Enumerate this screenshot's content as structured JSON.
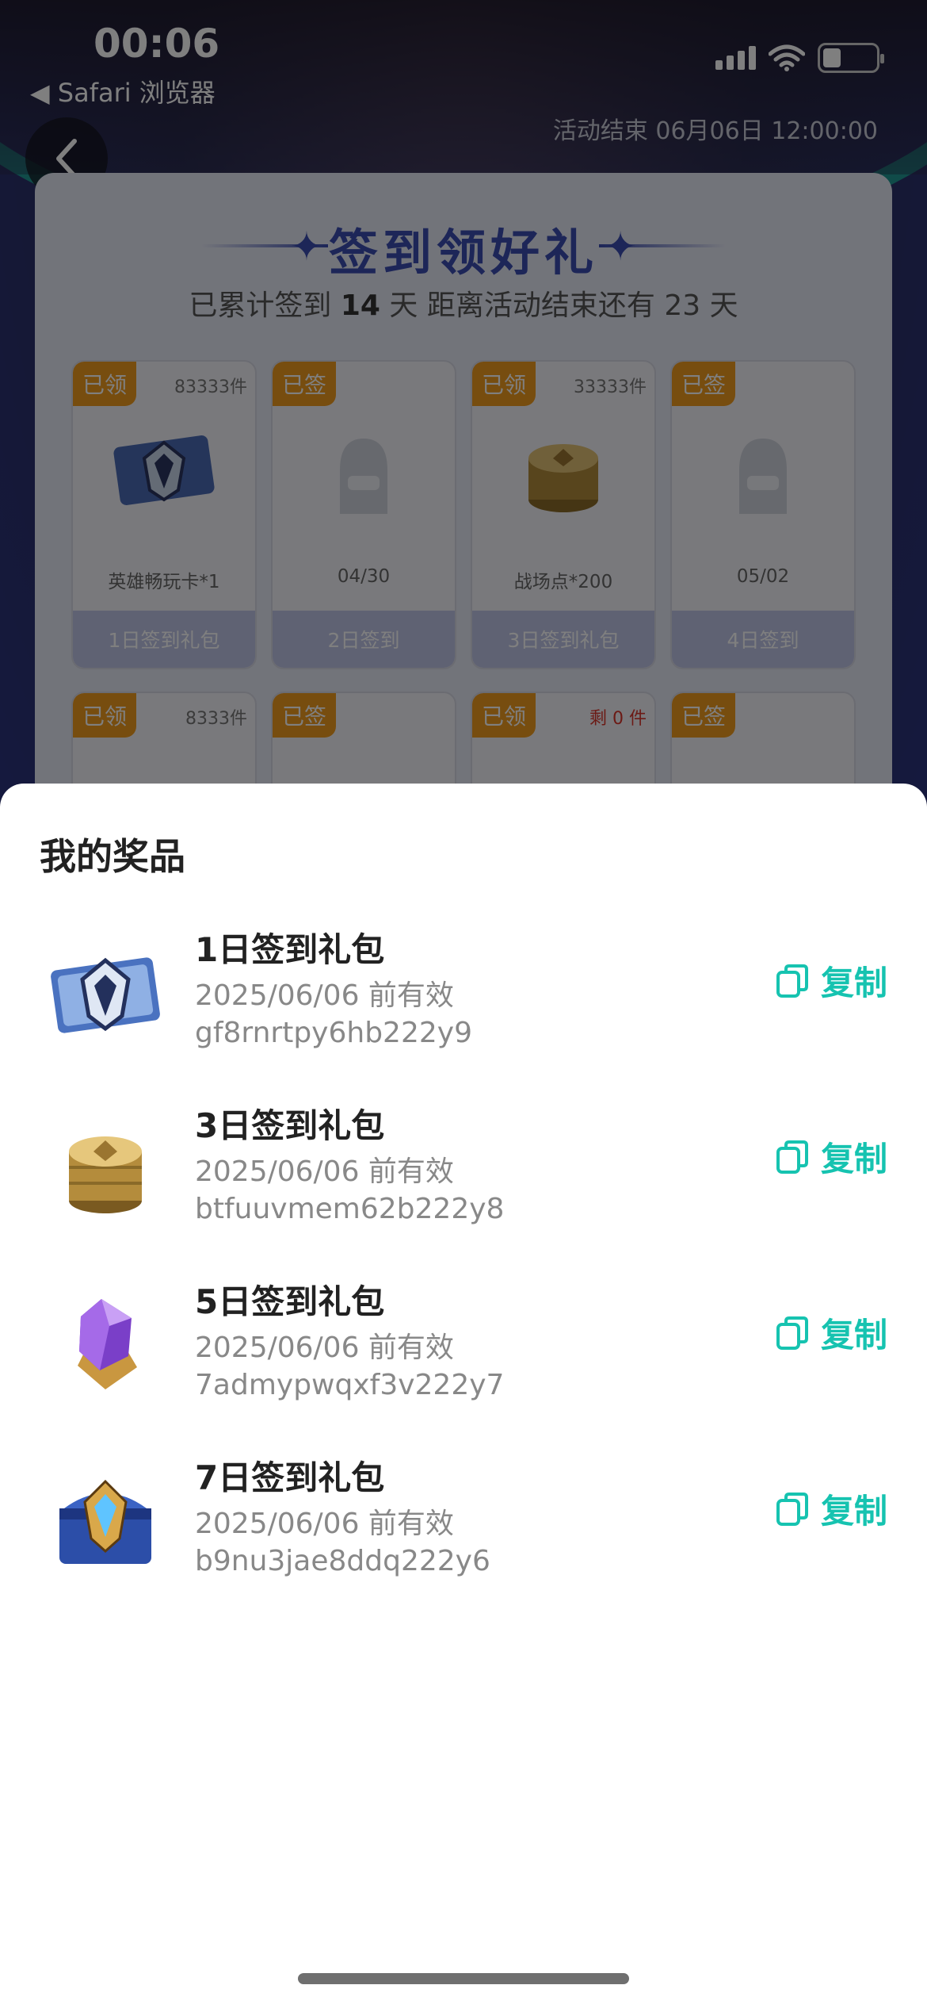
{
  "status_bar": {
    "time": "00:06",
    "back_app": "◀ Safari 浏览器"
  },
  "activity": {
    "end_time": "活动结束 06月06日 12:00:00"
  },
  "checkin_card": {
    "title": "签到领好礼",
    "summary_prefix": "已累计签到",
    "days_signed": "14",
    "summary_mid": "天  距离活动结束还有",
    "days_left": "23",
    "summary_suffix": "天",
    "rows": [
      [
        {
          "tag": "已领",
          "count": "83333件",
          "count_red": false,
          "image": "hero-card-icon",
          "name": "英雄畅玩卡*1",
          "footer": "1日签到礼包"
        },
        {
          "tag": "已签",
          "count": "",
          "count_red": false,
          "image": "placeholder-mascot-icon",
          "name": "04/30",
          "footer": "2日签到"
        },
        {
          "tag": "已领",
          "count": "33333件",
          "count_red": false,
          "image": "coin-stack-icon",
          "name": "战场点*200",
          "footer": "3日签到礼包"
        },
        {
          "tag": "已签",
          "count": "",
          "count_red": false,
          "image": "placeholder-mascot-icon",
          "name": "05/02",
          "footer": "4日签到"
        }
      ],
      [
        {
          "tag": "已领",
          "count": "8333件",
          "count_red": false
        },
        {
          "tag": "已签",
          "count": "",
          "count_red": false
        },
        {
          "tag": "已领",
          "count": "剩 0 件",
          "count_red": true
        },
        {
          "tag": "已签",
          "count": "",
          "count_red": false
        }
      ]
    ]
  },
  "sheet": {
    "title": "我的奖品",
    "copy_label": "复制",
    "prizes": [
      {
        "name": "1日签到礼包",
        "valid": "2025/06/06 前有效",
        "code": "gf8rnrtpy6hb222y9",
        "icon": "hero-card-icon"
      },
      {
        "name": "3日签到礼包",
        "valid": "2025/06/06 前有效",
        "code": "btfuuvmem62b222y8",
        "icon": "coin-stack-icon"
      },
      {
        "name": "5日签到礼包",
        "valid": "2025/06/06 前有效",
        "code": "7admypwqxf3v222y7",
        "icon": "purple-crystal-icon"
      },
      {
        "name": "7日签到礼包",
        "valid": "2025/06/06 前有效",
        "code": "b9nu3jae8ddq222y6",
        "icon": "treasure-chest-icon"
      }
    ]
  },
  "colors": {
    "accent_teal": "#16c3b0",
    "tag_orange": "#ef9a1e",
    "title_blue": "#3a4cb0"
  }
}
